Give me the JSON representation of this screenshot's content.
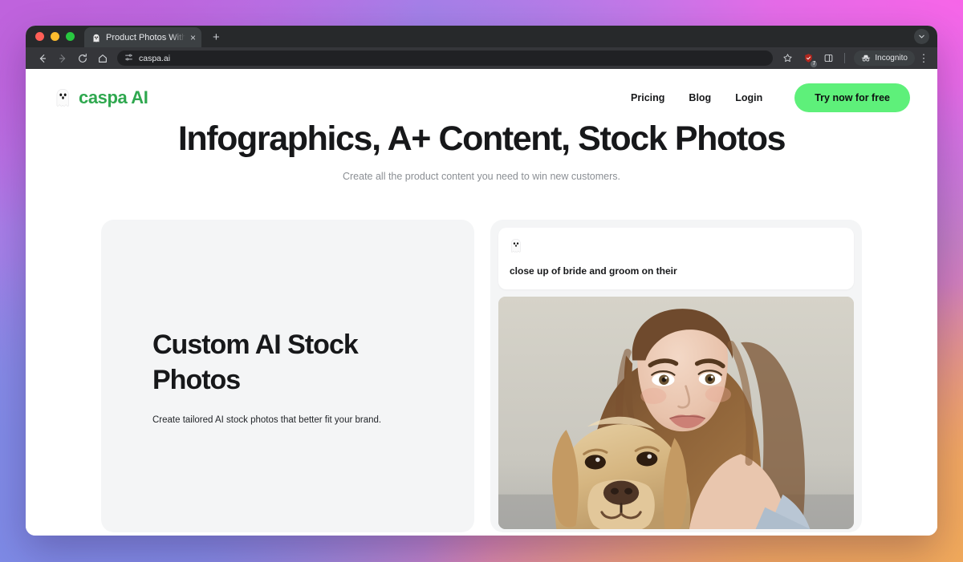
{
  "browser": {
    "tab": {
      "title": "Product Photos With Human",
      "favicon_icon": "ghost-icon",
      "close_icon": "×"
    },
    "new_tab_icon": "+",
    "tab_list_icon": "chevron-down-icon",
    "toolbar": {
      "back_icon": "arrow-left-icon",
      "forward_icon": "arrow-right-icon",
      "reload_icon": "reload-icon",
      "home_icon": "home-icon",
      "site_settings_icon": "tune-icon",
      "url": "caspa.ai",
      "bookmark_icon": "star-icon",
      "extensions_icon": "extension-icon",
      "extensions_badge": "7",
      "split_view_icon": "split-screen-icon",
      "incognito_label": "Incognito",
      "incognito_icon": "incognito-hat-icon",
      "menu_icon": "kebab-menu-icon"
    }
  },
  "site": {
    "brand": {
      "logo_icon": "ghost-icon",
      "name": "caspa AI",
      "color": "#2fa84f"
    },
    "nav": [
      {
        "label": "Pricing"
      },
      {
        "label": "Blog"
      },
      {
        "label": "Login"
      }
    ],
    "cta": {
      "label": "Try now for free",
      "color": "#5ef07a"
    },
    "hero": {
      "title": "Infographics, A+ Content, Stock Photos",
      "subtitle": "Create all the product content you need to win new customers."
    },
    "feature_card": {
      "title": "Custom AI Stock Photos",
      "description": "Create tailored AI stock photos that better fit your brand."
    },
    "preview_card": {
      "avatar_icon": "ghost-icon",
      "prompt": "close up of bride and groom on their",
      "image_alt": "Woman with golden retriever dog portrait"
    }
  }
}
